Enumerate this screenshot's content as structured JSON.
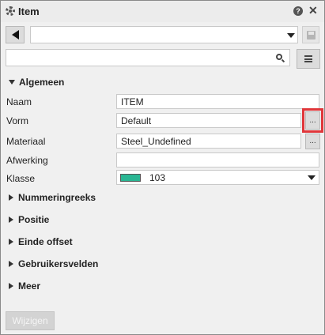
{
  "window": {
    "title": "Item"
  },
  "toolbar": {
    "select_value": ""
  },
  "search": {
    "value": ""
  },
  "sections": {
    "general": "Algemeen",
    "numbering": "Nummeringreeks",
    "position": "Positie",
    "end_offset": "Einde offset",
    "user_fields": "Gebruikersvelden",
    "more": "Meer"
  },
  "fields": {
    "name_label": "Naam",
    "name_value": "ITEM",
    "shape_label": "Vorm",
    "shape_value": "Default",
    "material_label": "Materiaal",
    "material_value": "Steel_Undefined",
    "finish_label": "Afwerking",
    "finish_value": "",
    "class_label": "Klasse",
    "class_value": "103",
    "class_color": "#2ab693"
  },
  "buttons": {
    "ellipsis": "...",
    "modify": "Wijzigen"
  },
  "highlight": {
    "color": "#e0363a"
  }
}
